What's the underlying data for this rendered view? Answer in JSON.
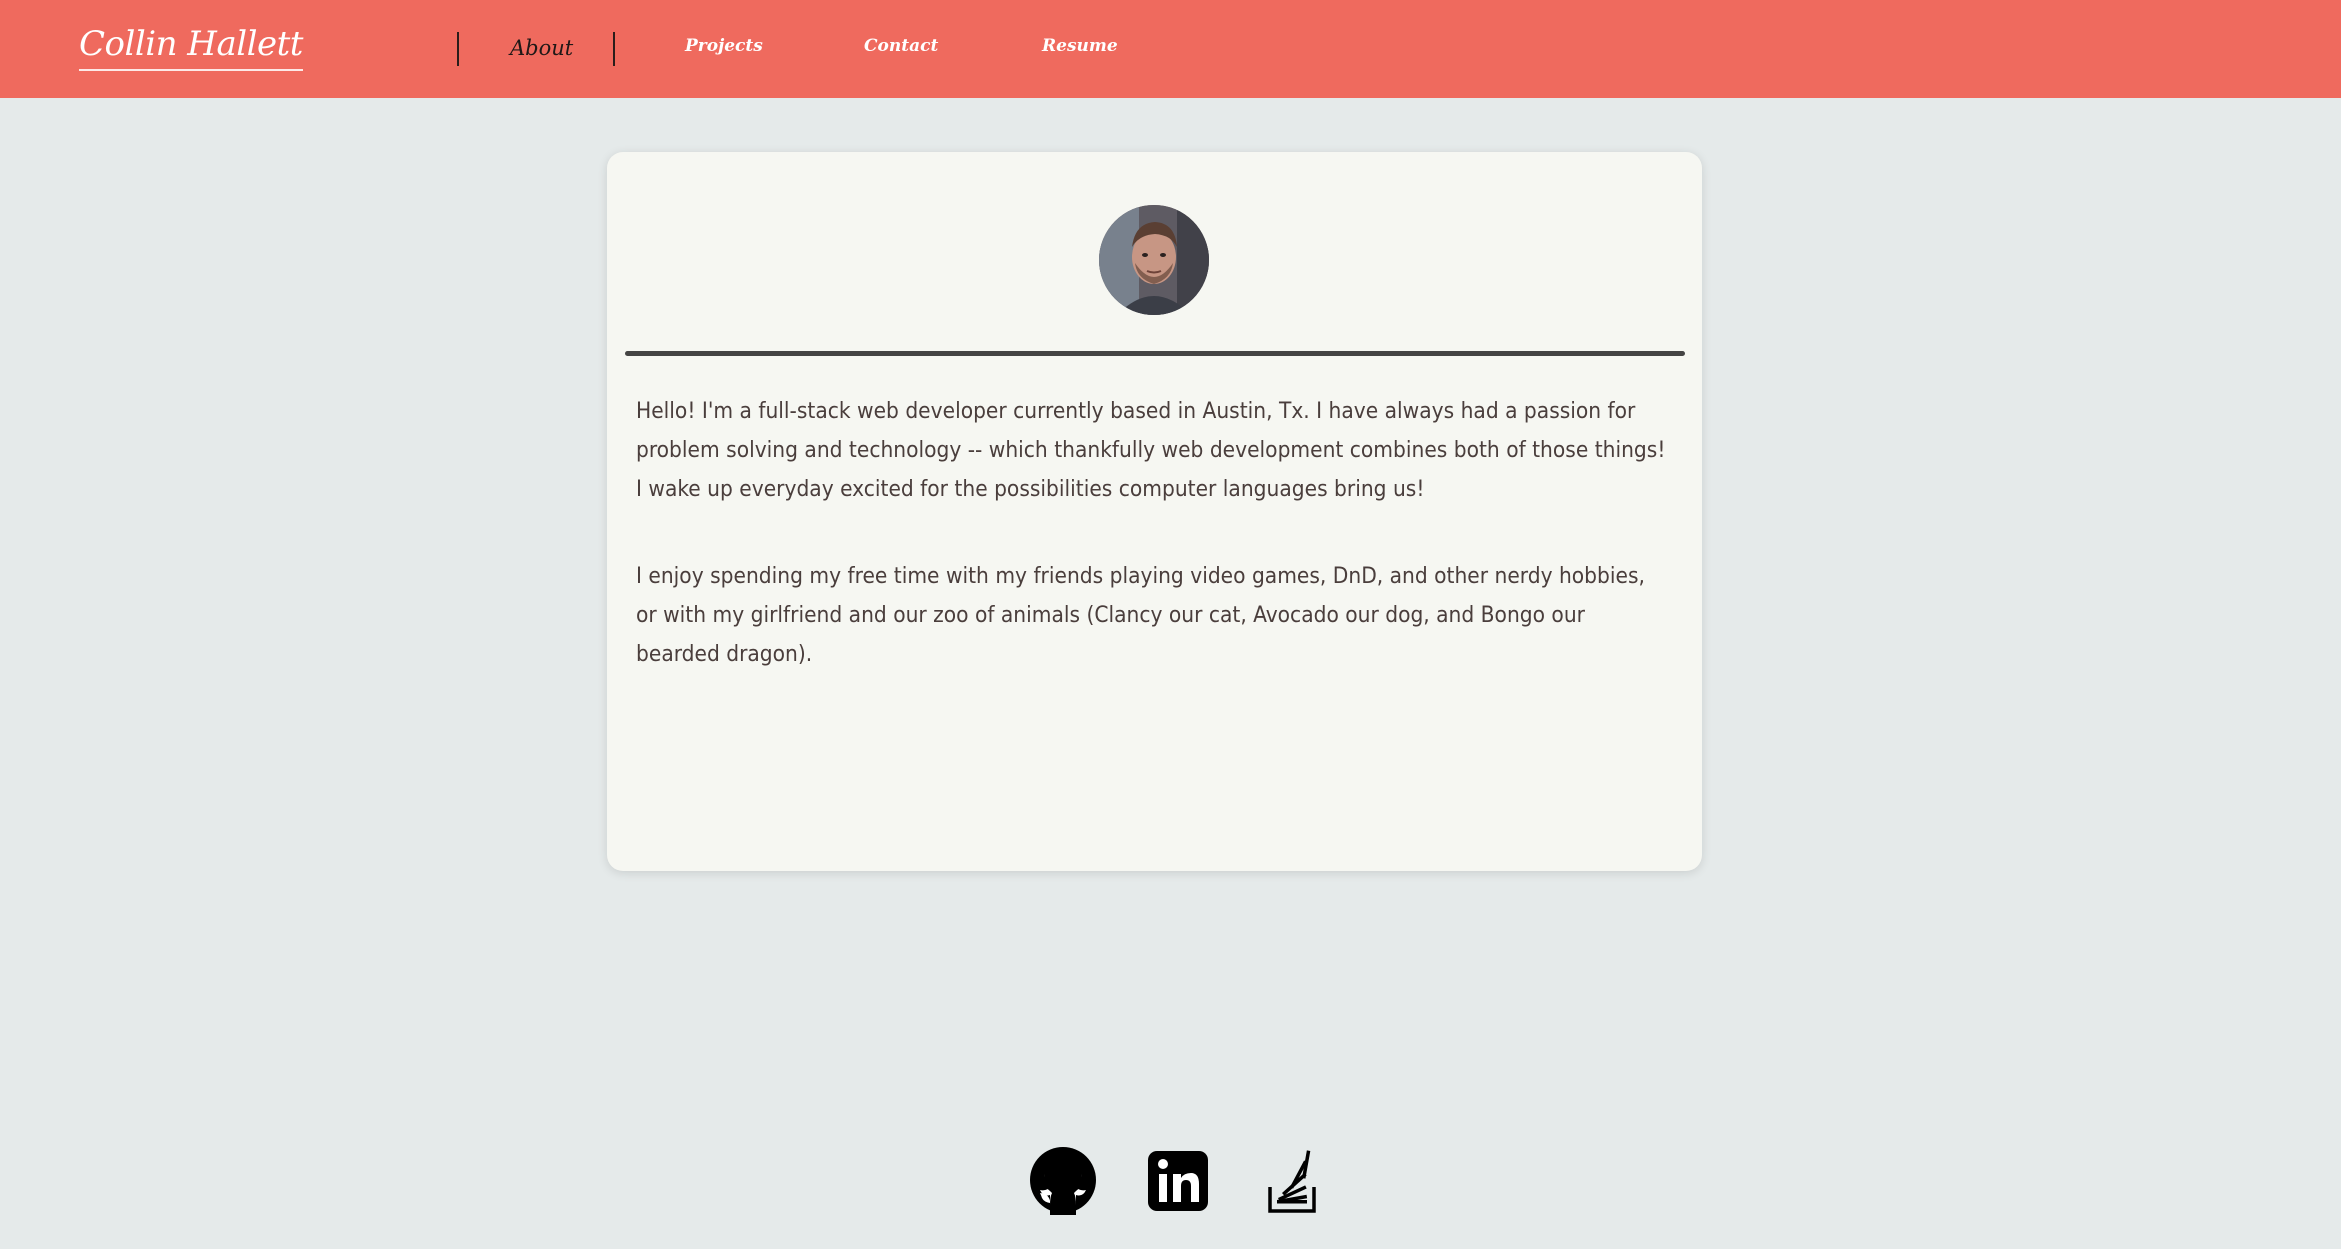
{
  "navbar": {
    "brand": "Collin Hallett",
    "links": [
      {
        "label": "About",
        "active": true
      },
      {
        "label": "Projects",
        "active": false
      },
      {
        "label": "Contact",
        "active": false
      },
      {
        "label": "Resume",
        "active": false
      }
    ]
  },
  "profile": {
    "avatar_icon": "profile-photo",
    "paragraphs": [
      "Hello! I'm a full-stack web developer currently based in Austin, Tx. I have always had a passion for problem solving and technology -- which thankfully web development combines both of those things! I wake up everyday excited for the possibilities computer languages bring us!",
      "I enjoy spending my free time with my friends playing video games, DnD, and other nerdy hobbies, or with my girlfriend and our zoo of animals (Clancy our cat, Avocado our dog, and Bongo our bearded dragon)."
    ]
  },
  "footer": {
    "social_icons": [
      "github-icon",
      "linkedin-icon",
      "stackoverflow-icon"
    ]
  },
  "colors": {
    "navbar": "#ef6a5e",
    "page_background": "#e5eaea",
    "card_background": "#f6f7f2",
    "active_link": "#1f1817",
    "body_text": "#4a3e3c"
  }
}
